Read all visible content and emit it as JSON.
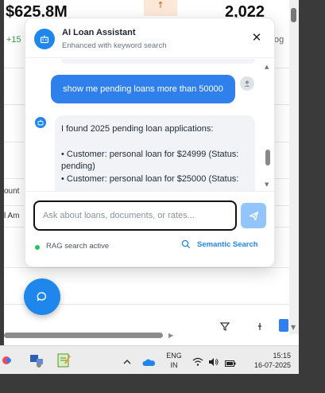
{
  "background": {
    "stat_left": "$625.8M",
    "stat_left_delta": "+15",
    "stat_right": "2,022",
    "stat_right_caption": "og",
    "orange_badge": "↑",
    "row_label_1": "ount",
    "row_label_2": "l Am"
  },
  "chat": {
    "title": "AI Loan Assistant",
    "subtitle": "Enhanced with keyword search",
    "close_label": "✕",
    "user_message": "show me pending loans more than 50000",
    "bot_intro": "I found 2025 pending loan applications:",
    "bot_items": [
      "• Customer: personal loan for $24999 (Status: pending)",
      "• Customer: personal loan for $25000 (Status:"
    ],
    "input_placeholder": "Ask about loans, documents, or rates...",
    "input_value": "",
    "rag_status": "RAG search active",
    "semantic_search_label": "Semantic Search"
  },
  "taskbar": {
    "lang_line1": "ENG",
    "lang_line2": "IN",
    "time": "15:15",
    "date": "16-07-2025"
  },
  "colors": {
    "accent": "#1f87ec",
    "user_bubble": "#2f80ed",
    "send_disabled": "#93c5fd",
    "rag_dot": "#22c55e"
  }
}
